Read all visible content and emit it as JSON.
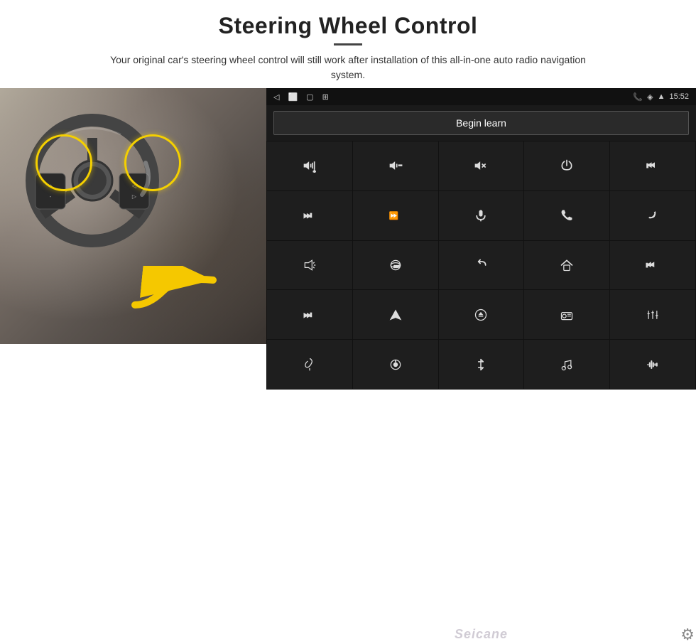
{
  "header": {
    "title": "Steering Wheel Control",
    "divider": true,
    "subtitle": "Your original car's steering wheel control will still work after installation of this all-in-one auto radio navigation system."
  },
  "android_ui": {
    "status_bar": {
      "left_icons": [
        "back-icon",
        "home-icon",
        "recent-icon",
        "media-icon"
      ],
      "time": "15:52",
      "right_icons": [
        "phone-icon",
        "location-icon",
        "wifi-icon"
      ]
    },
    "begin_learn_button": "Begin learn",
    "controls": [
      {
        "icon": "vol-up",
        "symbol": "🔊+"
      },
      {
        "icon": "vol-down",
        "symbol": "🔉-"
      },
      {
        "icon": "mute",
        "symbol": "🔇"
      },
      {
        "icon": "power",
        "symbol": "⏻"
      },
      {
        "icon": "prev-track",
        "symbol": "⏮"
      },
      {
        "icon": "next",
        "symbol": "⏭"
      },
      {
        "icon": "fast-fwd",
        "symbol": "⏩"
      },
      {
        "icon": "mic",
        "symbol": "🎙"
      },
      {
        "icon": "phone",
        "symbol": "📞"
      },
      {
        "icon": "hang-up",
        "symbol": "📵"
      },
      {
        "icon": "horn",
        "symbol": "📣"
      },
      {
        "icon": "cam-360",
        "symbol": "⊛"
      },
      {
        "icon": "back",
        "symbol": "↩"
      },
      {
        "icon": "home",
        "symbol": "⌂"
      },
      {
        "icon": "skip-back",
        "symbol": "⏮⏮"
      },
      {
        "icon": "skip-fwd",
        "symbol": "⏭"
      },
      {
        "icon": "nav",
        "symbol": "▶"
      },
      {
        "icon": "eq",
        "symbol": "⊝"
      },
      {
        "icon": "radio",
        "symbol": "📻"
      },
      {
        "icon": "settings-adj",
        "symbol": "⊞"
      },
      {
        "icon": "mic2",
        "symbol": "🎤"
      },
      {
        "icon": "knob",
        "symbol": "◎"
      },
      {
        "icon": "bluetooth",
        "symbol": "⚡"
      },
      {
        "icon": "music",
        "symbol": "♫"
      },
      {
        "icon": "equalizer",
        "symbol": "▮▮▮"
      }
    ],
    "watermark": "Seicane",
    "gear_icon": "⚙"
  }
}
